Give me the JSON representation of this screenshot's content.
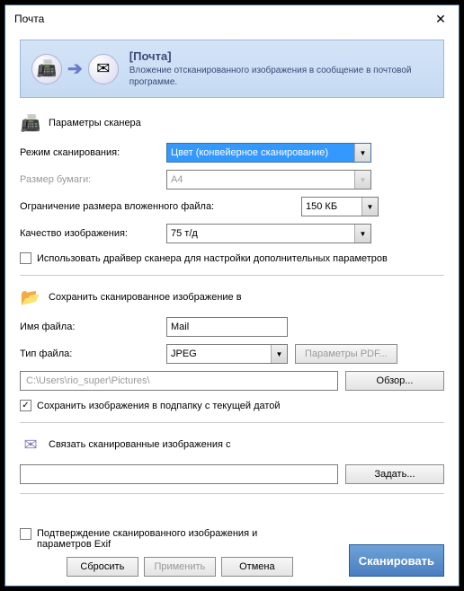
{
  "window": {
    "title": "Почта"
  },
  "banner": {
    "title": "[Почта]",
    "description": "Вложение отсканированного изображения в сообщение в почтовой программе."
  },
  "sections": {
    "scanner": {
      "title": "Параметры сканера",
      "scan_mode_label": "Режим сканирования:",
      "scan_mode_value": "Цвет (конвейерное сканирование)",
      "paper_size_label": "Размер бумаги:",
      "paper_size_value": "A4",
      "attachment_limit_label": "Ограничение размера вложенного файла:",
      "attachment_limit_value": "150 КБ",
      "image_quality_label": "Качество изображения:",
      "image_quality_value": "75 т/д",
      "use_driver_label": "Использовать драйвер сканера для настройки дополнительных параметров"
    },
    "save": {
      "title": "Сохранить сканированное изображение в",
      "filename_label": "Имя файла:",
      "filename_value": "Mail",
      "filetype_label": "Тип файла:",
      "filetype_value": "JPEG",
      "pdf_params_label": "Параметры PDF...",
      "path_value": "C:\\Users\\rio_super\\Pictures\\",
      "browse_label": "Обзор...",
      "subfolder_label": "Сохранить изображения в подпапку с текущей датой"
    },
    "link": {
      "title": "Связать сканированные изображения с",
      "set_label": "Задать...",
      "empty": ""
    }
  },
  "footer": {
    "confirm_label": "Подтверждение сканированного изображения и параметров Exif",
    "reset_label": "Сбросить",
    "apply_label": "Применить",
    "cancel_label": "Отмена",
    "scan_label": "Сканировать"
  }
}
